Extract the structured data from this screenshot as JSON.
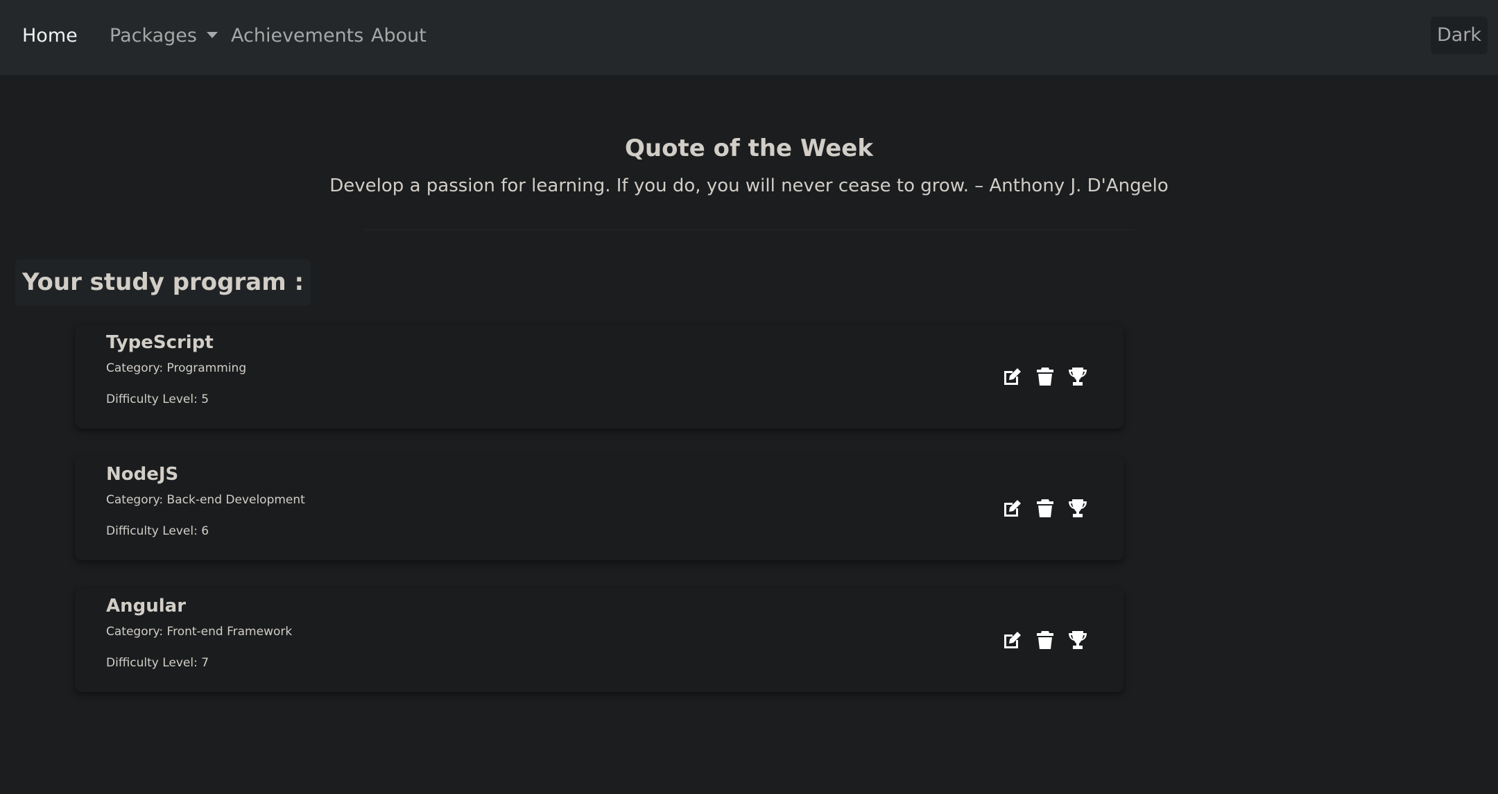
{
  "nav": {
    "home": "Home",
    "packages": "Packages",
    "achievements": "Achievements",
    "about": "About",
    "theme_toggle": "Dark"
  },
  "quote": {
    "title": "Quote of the Week",
    "text": "Develop a passion for learning. If you do, you will never cease to grow. – Anthony J. D'Angelo"
  },
  "program": {
    "heading": "Your study program :",
    "items": [
      {
        "title": "TypeScript",
        "category": "Category: Programming",
        "difficulty": "Difficulty Level: 5"
      },
      {
        "title": "NodeJS",
        "category": "Category: Back-end Development",
        "difficulty": "Difficulty Level: 6"
      },
      {
        "title": "Angular",
        "category": "Category: Front-end Framework",
        "difficulty": "Difficulty Level: 7"
      }
    ]
  },
  "icons": {
    "edit": "edit-icon",
    "delete": "trash-icon",
    "achievement": "trophy-icon",
    "dropdown": "caret-down-icon"
  },
  "colors": {
    "background": "#1b1d1f",
    "navbar": "#24282b",
    "text": "#d2cec7",
    "nav_text": "#a7a7a7",
    "nav_active": "#f2f2f2"
  }
}
